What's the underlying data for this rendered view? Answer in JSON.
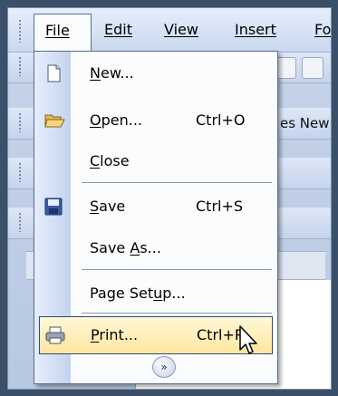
{
  "menubar": {
    "items": [
      {
        "label": "File",
        "underline": "F"
      },
      {
        "label": "Edit",
        "underline": "E"
      },
      {
        "label": "View",
        "underline": "V"
      },
      {
        "label": "Insert",
        "underline": "I"
      },
      {
        "label": "Fo",
        "underline": "F"
      }
    ]
  },
  "background": {
    "font_box_partial": "es New"
  },
  "file_menu": {
    "items": [
      {
        "label_pre": "",
        "label_ul": "N",
        "label_post": "ew...",
        "shortcut": "",
        "icon": "new-document-icon"
      },
      {
        "label_pre": "",
        "label_ul": "O",
        "label_post": "pen...",
        "shortcut": "Ctrl+O",
        "icon": "open-folder-icon"
      },
      {
        "label_pre": "",
        "label_ul": "C",
        "label_post": "lose",
        "shortcut": "",
        "icon": ""
      },
      {
        "label_pre": "",
        "label_ul": "S",
        "label_post": "ave",
        "shortcut": "Ctrl+S",
        "icon": "save-disk-icon"
      },
      {
        "label_pre": "Save ",
        "label_ul": "A",
        "label_post": "s...",
        "shortcut": "",
        "icon": ""
      },
      {
        "label_pre": "Page Set",
        "label_ul": "u",
        "label_post": "p...",
        "shortcut": "",
        "icon": ""
      },
      {
        "label_pre": "",
        "label_ul": "P",
        "label_post": "rint...",
        "shortcut": "Ctrl+P",
        "icon": "printer-icon"
      }
    ],
    "highlighted_index": 6,
    "expand_glyph": "»",
    "expand_icon": "chevron-double-down-icon"
  },
  "colors": {
    "highlight_fill": "#ffe6a0",
    "highlight_border": "#2c4a7a",
    "gutter": "#c3d3ee"
  }
}
